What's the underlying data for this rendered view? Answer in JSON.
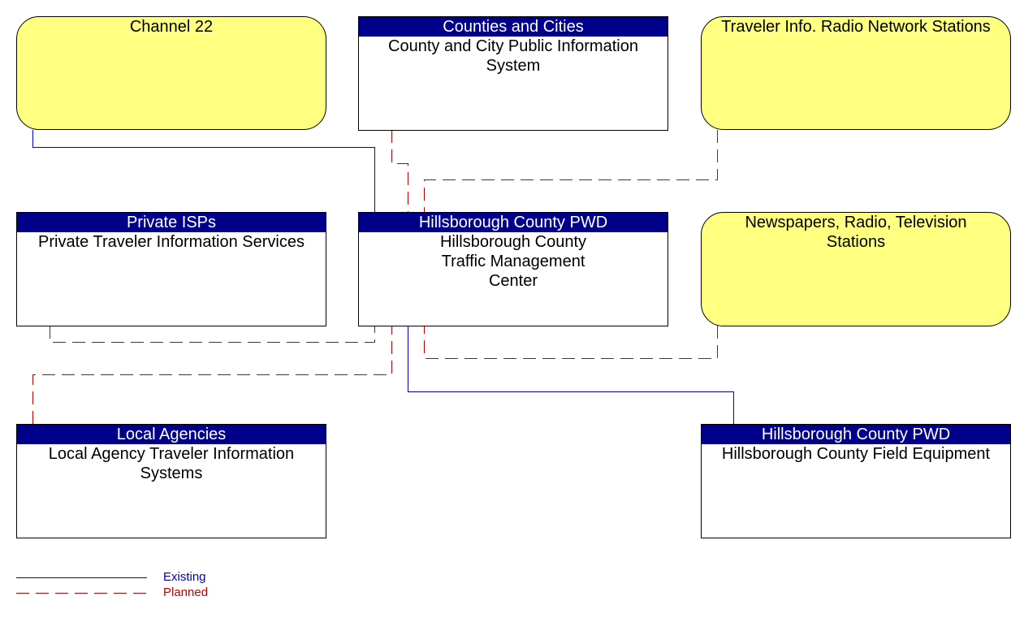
{
  "nodes": {
    "channel22": {
      "name": "Channel 22"
    },
    "county_city": {
      "header": "Counties and Cities",
      "name": "County and City Public Information System"
    },
    "tirns": {
      "name": "Traveler Info. Radio Network Stations"
    },
    "private_isps": {
      "header": "Private ISPs",
      "name": "Private Traveler Information Services"
    },
    "tmc": {
      "header": "Hillsborough County PWD",
      "name": "Hillsborough County Traffic Management Center"
    },
    "media": {
      "name": "Newspapers, Radio, Television Stations"
    },
    "local_agencies": {
      "header": "Local Agencies",
      "name": "Local Agency Traveler Information Systems"
    },
    "field_equipment": {
      "header": "Hillsborough County PWD",
      "name": "Hillsborough County Field Equipment"
    }
  },
  "connections": [
    {
      "from": "Channel 22",
      "to": "Hillsborough County Traffic Management Center",
      "status": "Existing"
    },
    {
      "from": "County and City Public Information System",
      "to": "Hillsborough County Traffic Management Center",
      "status": "Planned"
    },
    {
      "from": "Traveler Info. Radio Network Stations",
      "to": "Hillsborough County Traffic Management Center",
      "status": "Planned"
    },
    {
      "from": "Private Traveler Information Services",
      "to": "Hillsborough County Traffic Management Center",
      "status": "Planned"
    },
    {
      "from": "Local Agency Traveler Information Systems",
      "to": "Hillsborough County Traffic Management Center",
      "status": "Planned"
    },
    {
      "from": "Newspapers, Radio, Television Stations",
      "to": "Hillsborough County Traffic Management Center",
      "status": "Planned"
    },
    {
      "from": "Hillsborough County Field Equipment",
      "to": "Hillsborough County Traffic Management Center",
      "status": "Existing"
    }
  ],
  "legend": {
    "existing": "Existing",
    "planned": "Planned"
  },
  "colors": {
    "existing": "#0000c0",
    "planned": "#c00000",
    "header": "#00008b",
    "external": "#ffff80"
  }
}
